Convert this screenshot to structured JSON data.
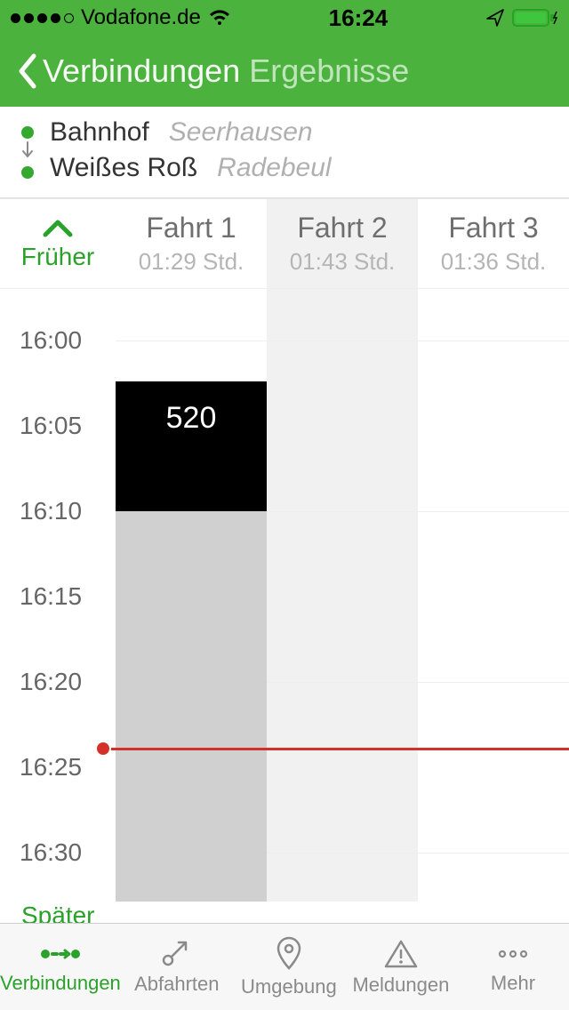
{
  "status": {
    "carrier": "Vodafone.de",
    "time": "16:24"
  },
  "nav": {
    "back_label": "Verbindungen",
    "title": "Ergebnisse"
  },
  "route": {
    "from_name": "Bahnhof",
    "from_city": "Seerhausen",
    "to_name": "Weißes Roß",
    "to_city": "Radebeul"
  },
  "earlier_label": "Früher",
  "later_label": "Später",
  "trips": [
    {
      "label": "Fahrt 1",
      "duration": "01:29 Std."
    },
    {
      "label": "Fahrt 2",
      "duration": "01:43 Std."
    },
    {
      "label": "Fahrt 3",
      "duration": "01:36 Std."
    }
  ],
  "timeline": {
    "ticks": [
      "16:00",
      "16:05",
      "16:10",
      "16:15",
      "16:20",
      "16:25",
      "16:30"
    ],
    "block_line": "520"
  },
  "tabs": {
    "connections": "Verbindungen",
    "departures": "Abfahrten",
    "surroundings": "Umgebung",
    "alerts": "Meldungen",
    "more": "Mehr"
  }
}
